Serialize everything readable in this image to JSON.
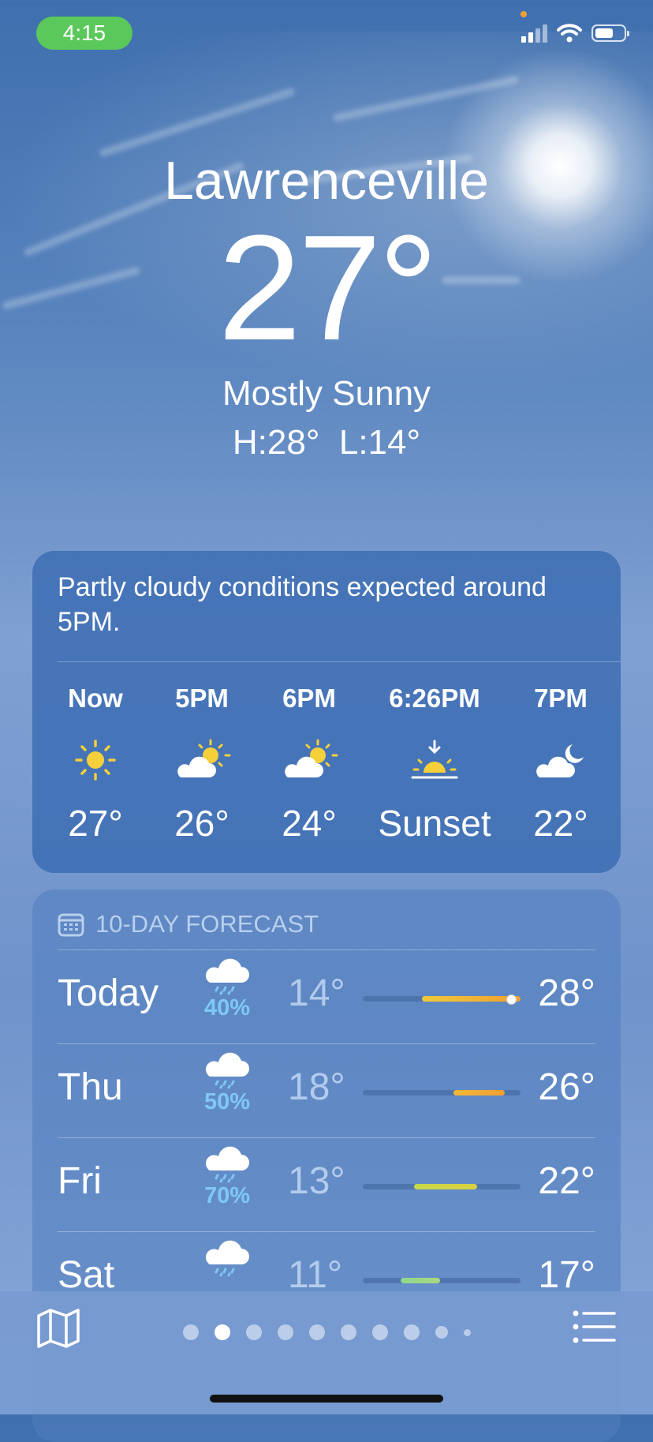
{
  "status_bar": {
    "time": "4:15"
  },
  "current": {
    "city": "Lawrenceville",
    "temperature": "27°",
    "condition": "Mostly Sunny",
    "hi_lo": "H:28°  L:14°"
  },
  "hourly": {
    "summary": "Partly cloudy conditions expected around 5PM.",
    "items": [
      {
        "label": "Now",
        "icon": "sun-icon",
        "value": "27°"
      },
      {
        "label": "5PM",
        "icon": "partly-cloudy-icon",
        "value": "26°"
      },
      {
        "label": "6PM",
        "icon": "partly-cloudy-icon",
        "value": "24°"
      },
      {
        "label": "6:26PM",
        "icon": "sunset-icon",
        "value": "Sunset"
      },
      {
        "label": "7PM",
        "icon": "partly-cloudy-night-icon",
        "value": "22°"
      }
    ]
  },
  "forecast": {
    "title": "10-DAY FORECAST",
    "days": [
      {
        "day": "Today",
        "precip": "40%",
        "low": "14°",
        "high": "28°",
        "icon": "rain-cloud-icon"
      },
      {
        "day": "Thu",
        "precip": "50%",
        "low": "18°",
        "high": "26°",
        "icon": "rain-cloud-icon"
      },
      {
        "day": "Fri",
        "precip": "70%",
        "low": "13°",
        "high": "22°",
        "icon": "rain-cloud-icon"
      },
      {
        "day": "Sat",
        "precip": "",
        "low": "11°",
        "high": "17°",
        "icon": "rain-cloud-icon"
      }
    ]
  },
  "bottom_bar": {
    "map_icon": "map-icon",
    "list_icon": "list-icon",
    "pages": 10,
    "active_page": 2
  }
}
